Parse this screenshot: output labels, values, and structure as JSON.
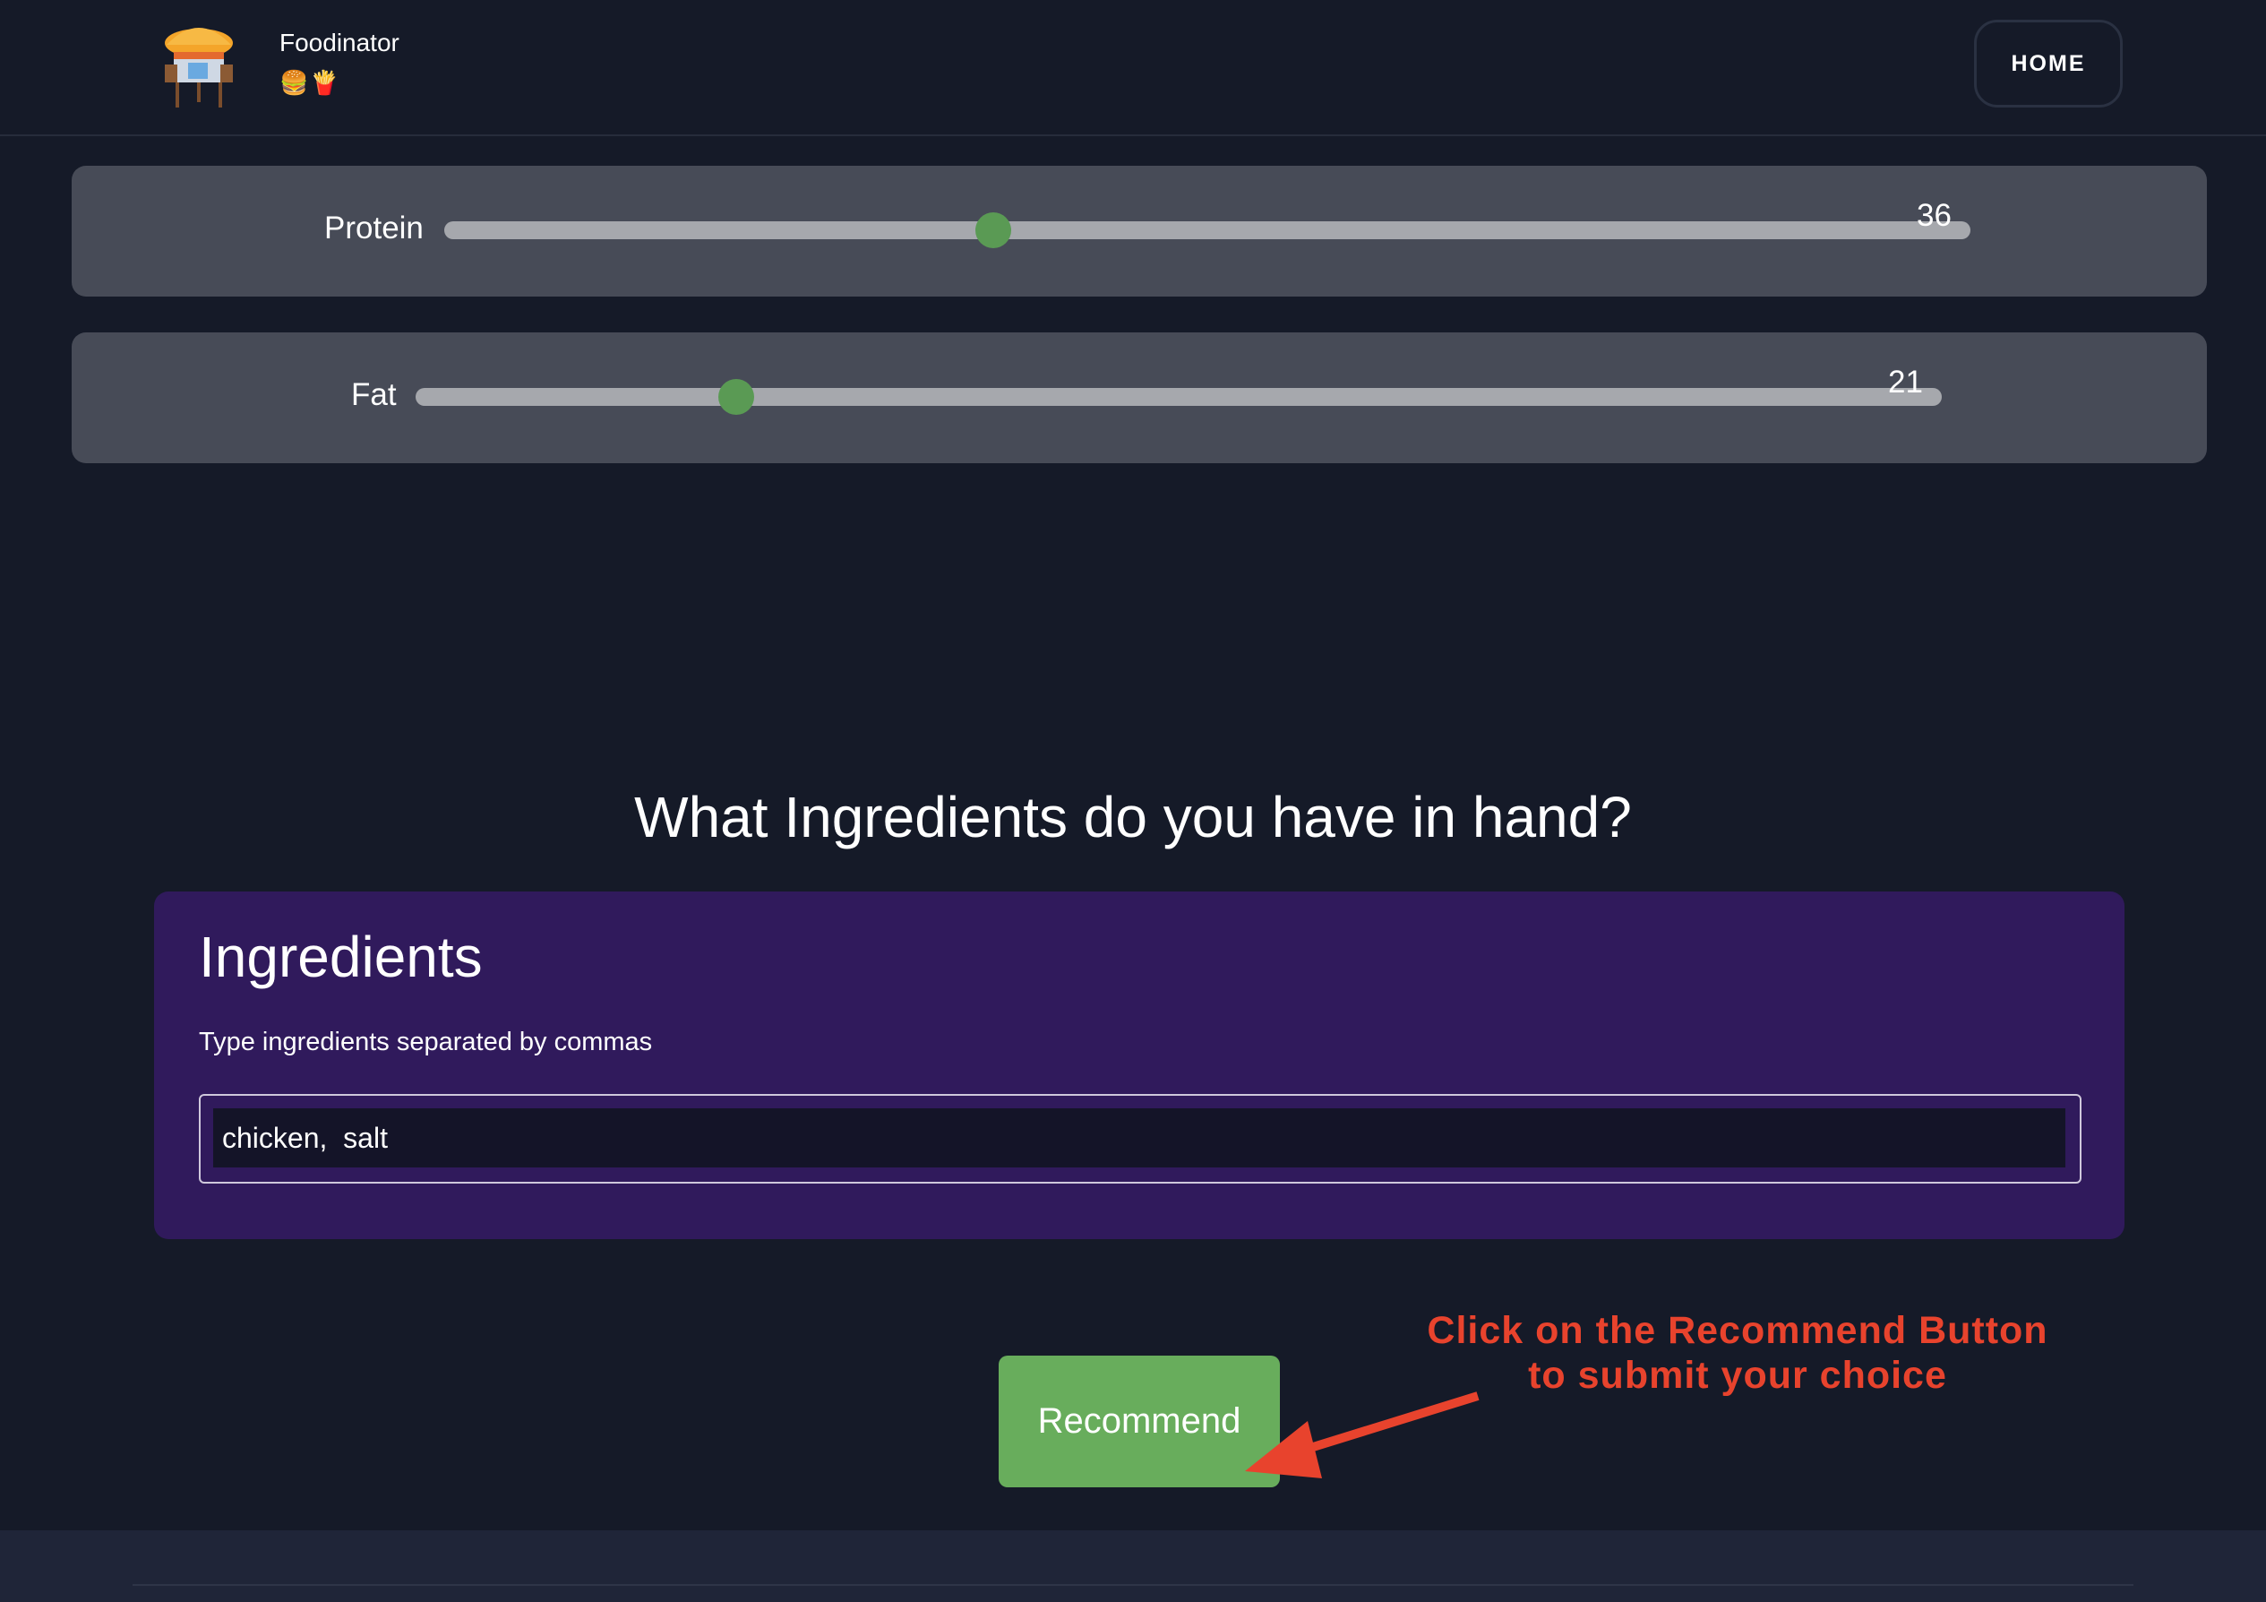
{
  "header": {
    "brand_name": "Foodinator",
    "brand_emojis": "🍔🍟",
    "home_label": "HOME",
    "logo_icon": "food-stall-icon"
  },
  "sliders": {
    "protein": {
      "label": "Protein",
      "value": "36",
      "level": 0.36
    },
    "fat": {
      "label": "Fat",
      "value": "21",
      "level": 0.21
    }
  },
  "question": "What Ingredients do you have in hand?",
  "ingredients": {
    "title": "Ingredients",
    "help": "Type ingredients separated by commas",
    "value": "chicken,  salt"
  },
  "recommend_label": "Recommend",
  "annotation": {
    "line1": "Click on the Recommend Button",
    "line2": "to submit your choice"
  },
  "colors": {
    "background": "#151a28",
    "slider_card": "#474b57",
    "slider_thumb": "#5a9a54",
    "panel": "#301a5c",
    "button": "#68ad5c",
    "annotation": "#e8432d"
  }
}
